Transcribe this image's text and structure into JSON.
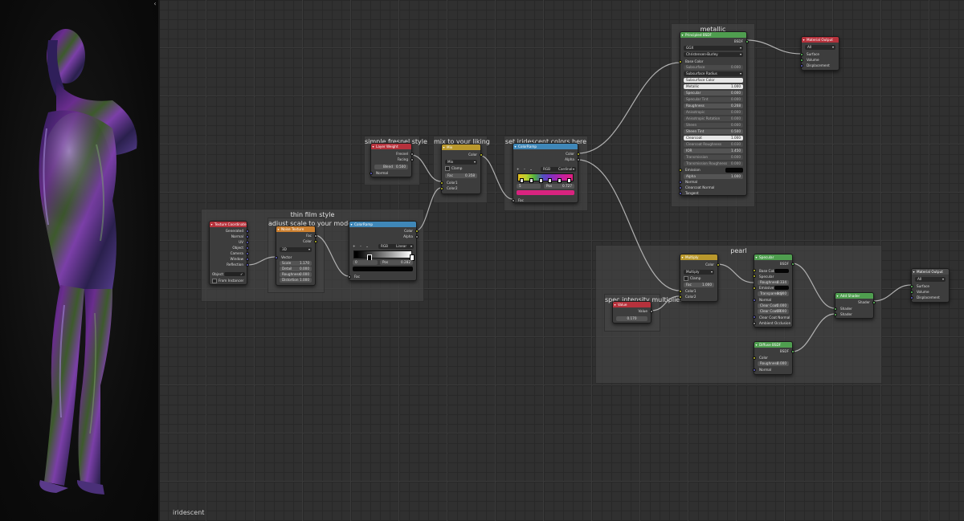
{
  "material_name": "iridescent",
  "viewport": {
    "collapse_icon": "chevron-left-icon"
  },
  "frames": {
    "thin_film": "thin film style",
    "adjust_scale": "adjust scale to your model",
    "simple_fresnel": "simple fresnel style",
    "mix_liking": "mix to your liking",
    "set_iridescent": "set iridescent colors here",
    "metallic": "metallic",
    "pearl": "pearl",
    "spec_intensity": "spec intensity multiplier"
  },
  "nodes": {
    "texcoord": {
      "title": "Texture Coordinate",
      "outputs": [
        "Generated",
        "Normal",
        "UV",
        "Object",
        "Camera",
        "Window",
        "Reflection"
      ],
      "object_label": "Object:",
      "from_instancer": "From Instancer"
    },
    "noise": {
      "title": "Noise Texture",
      "outputs": [
        "Fac",
        "Color"
      ],
      "dimension": "3D",
      "vector": "Vector",
      "fields": [
        {
          "label": "Scale",
          "value": "1.170"
        },
        {
          "label": "Detail",
          "value": "0.000"
        },
        {
          "label": "Roughness",
          "value": "0.000"
        },
        {
          "label": "Distortion",
          "value": "1.000"
        }
      ]
    },
    "ramp1": {
      "title": "ColorRamp",
      "outputs": [
        "Color",
        "Alpha"
      ],
      "mode": "RGB",
      "interp": "Linear",
      "index": "0",
      "pos_label": "Pos",
      "pos": "0.282",
      "fac": "Fac"
    },
    "layer_weight": {
      "title": "Layer Weight",
      "outputs": [
        "Fresnel",
        "Facing"
      ],
      "blend_label": "Blend",
      "blend": "0.500",
      "normal": "Normal"
    },
    "mix": {
      "title": "Mix",
      "output": "Color",
      "mode": "Mix",
      "clamp": "Clamp",
      "fac_label": "Fac",
      "fac": "0.358",
      "color1": "Color1",
      "color2": "Color2"
    },
    "ramp2": {
      "title": "ColorRamp",
      "outputs": [
        "Color",
        "Alpha"
      ],
      "mode": "RGB",
      "interp": "Cardinal",
      "index": "5",
      "pos_label": "Pos",
      "pos": "0.727",
      "fac": "Fac"
    },
    "principled": {
      "title": "Principled BSDF",
      "output": "BSDF",
      "distribution": "GGX",
      "subsurface_method": "Christensen-Burley",
      "base_color": "Base Color",
      "rows": [
        {
          "label": "Subsurface",
          "value": "0.000",
          "style": "dim"
        },
        {
          "label": "Subsurface Radius",
          "value": "",
          "style": "dd"
        },
        {
          "label": "Subsurface Color",
          "value": "",
          "style": "white"
        },
        {
          "label": "Metallic",
          "value": "1.000",
          "style": "white"
        },
        {
          "label": "Specular",
          "value": "0.000",
          "style": "normal"
        },
        {
          "label": "Specular Tint",
          "value": "0.000",
          "style": "dim"
        },
        {
          "label": "Roughness",
          "value": "0.268",
          "style": "normal"
        },
        {
          "label": "Anisotropic",
          "value": "0.000",
          "style": "dim"
        },
        {
          "label": "Anisotropic Rotation",
          "value": "0.000",
          "style": "dim"
        },
        {
          "label": "Sheen",
          "value": "0.000",
          "style": "dim"
        },
        {
          "label": "Sheen Tint",
          "value": "0.500",
          "style": "normal"
        },
        {
          "label": "Clearcoat",
          "value": "1.000",
          "style": "white"
        },
        {
          "label": "Clearcoat Roughness",
          "value": "0.030",
          "style": "dim"
        },
        {
          "label": "IOR",
          "value": "1.450",
          "style": "normal"
        },
        {
          "label": "Transmission",
          "value": "0.000",
          "style": "dim"
        },
        {
          "label": "Transmission Roughness",
          "value": "0.000",
          "style": "dim"
        }
      ],
      "emission": "Emission",
      "alpha_label": "Alpha",
      "alpha": "1.000",
      "inputs_tail": [
        "Normal",
        "Clearcoat Normal",
        "Tangent"
      ]
    },
    "out1": {
      "title": "Material Output",
      "target": "All",
      "inputs": [
        "Surface",
        "Volume",
        "Displacement"
      ]
    },
    "multiply": {
      "title": "Multiply",
      "output": "Color",
      "mode": "Multiply",
      "clamp": "Clamp",
      "fac_label": "Fac",
      "fac": "1.000",
      "color1": "Color1",
      "color2": "Color2"
    },
    "value": {
      "title": "Value",
      "output": "Value",
      "value": "0.170"
    },
    "specular": {
      "title": "Specular",
      "output": "BSDF",
      "rows": [
        {
          "label": "Base Color",
          "value": "",
          "style": "swatch"
        },
        {
          "label": "Specular",
          "value": "",
          "style": "label"
        },
        {
          "label": "Roughness",
          "value": "0.334",
          "style": "normal"
        },
        {
          "label": "Emissive",
          "value": "",
          "style": "swatch"
        },
        {
          "label": "Transparency",
          "value": "0.000",
          "style": "normal"
        },
        {
          "label": "Normal",
          "value": "",
          "style": "label"
        },
        {
          "label": "Clear Coat",
          "value": "0.000",
          "style": "normal"
        },
        {
          "label": "Clear Coat R",
          "value": "0.000",
          "style": "normal"
        },
        {
          "label": "Clear Coat Normal",
          "value": "",
          "style": "label"
        },
        {
          "label": "Ambient Occlusion",
          "value": "",
          "style": "label"
        }
      ]
    },
    "diffuse": {
      "title": "Diffuse BSDF",
      "output": "BSDF",
      "color": "Color",
      "roughness_label": "Roughness",
      "roughness": "0.000",
      "normal": "Normal"
    },
    "add": {
      "title": "Add Shader",
      "output": "Shader",
      "inputs": [
        "Shader",
        "Shader"
      ]
    },
    "out2": {
      "title": "Material Output",
      "target": "All",
      "inputs": [
        "Surface",
        "Volume",
        "Displacement"
      ]
    }
  }
}
